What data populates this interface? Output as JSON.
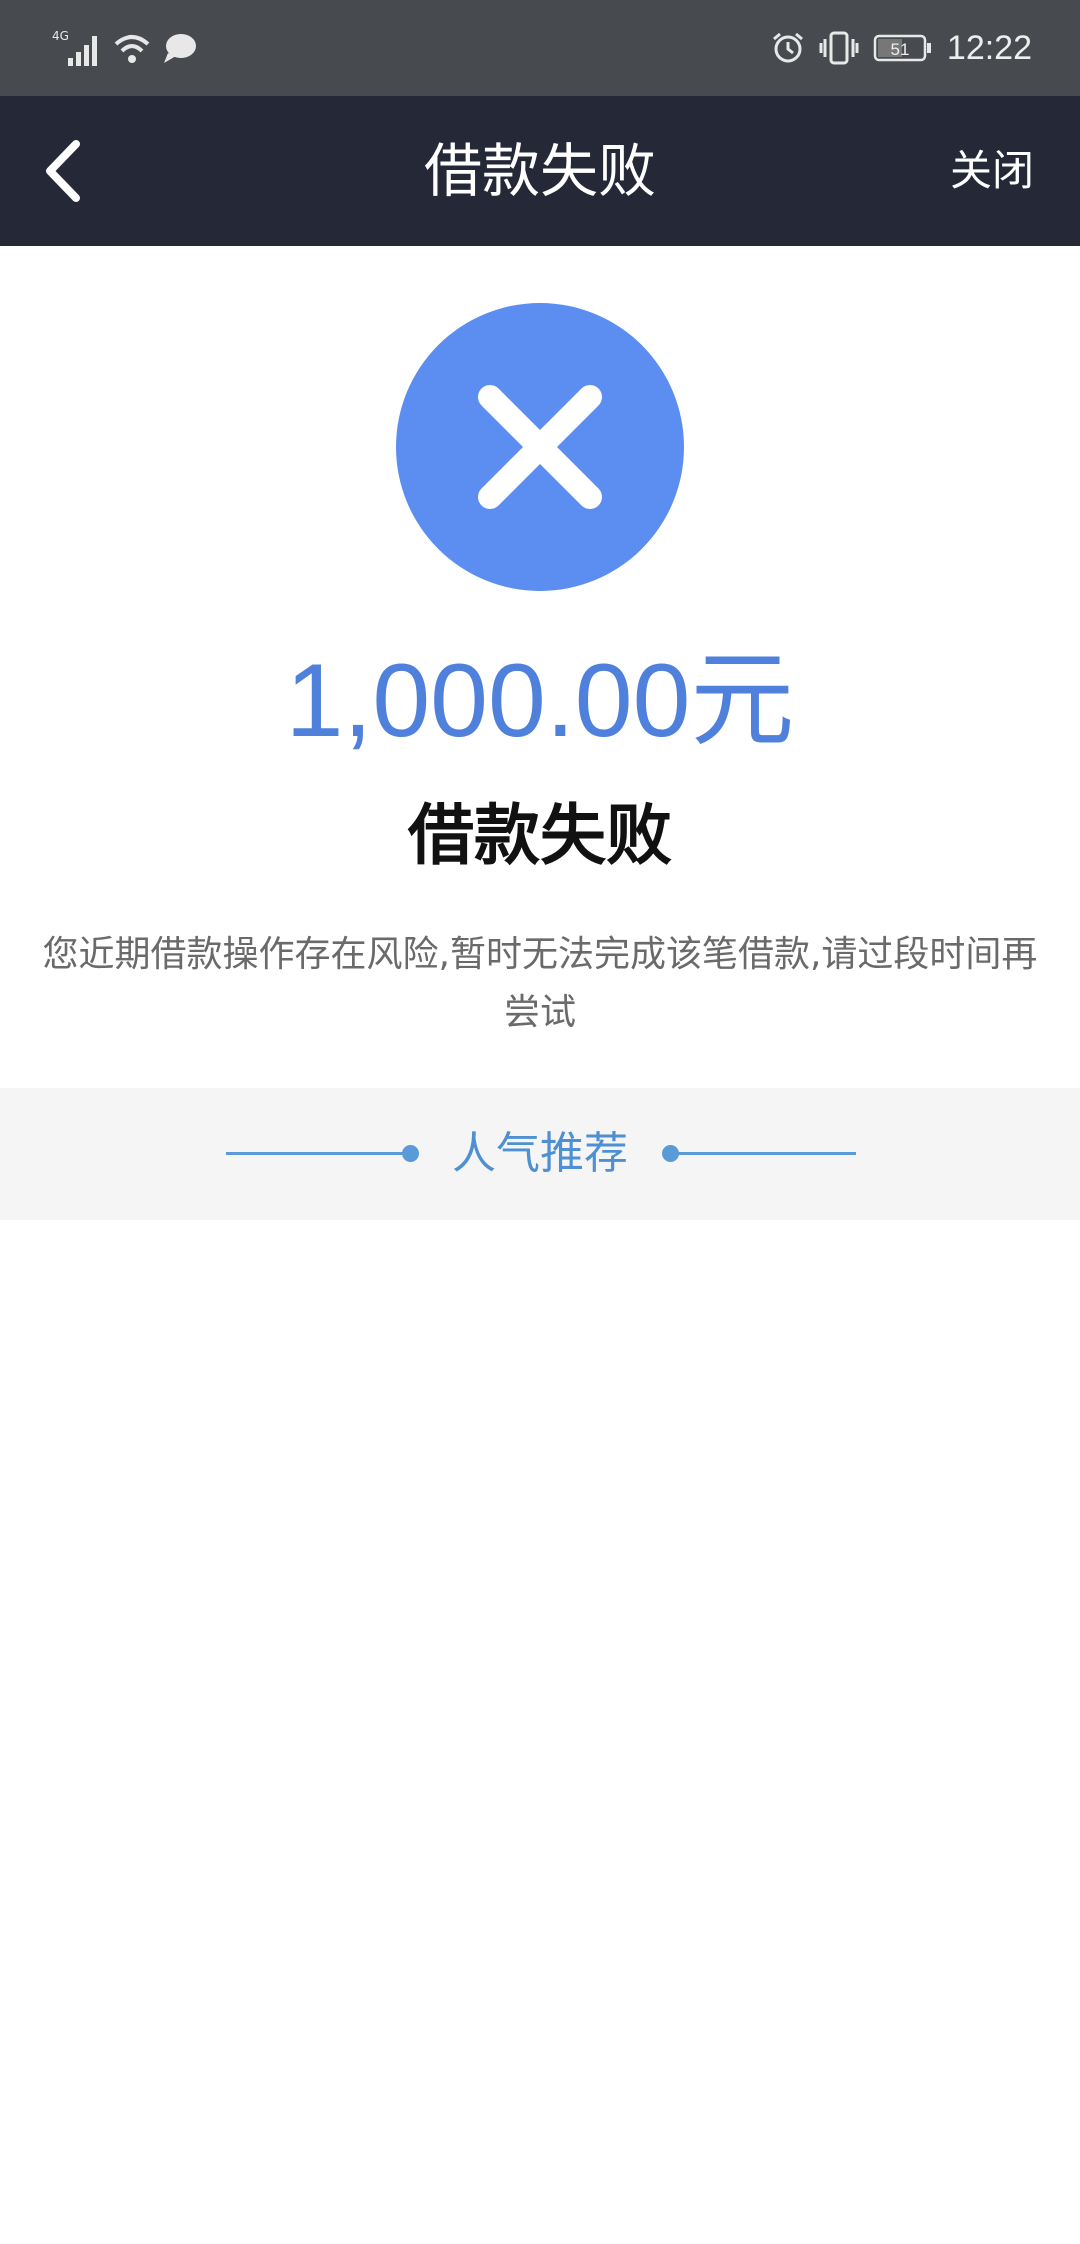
{
  "status_bar": {
    "network": "4G",
    "battery": "51",
    "time": "12:22",
    "icons": [
      "signal-icon",
      "wifi-icon",
      "message-icon",
      "alarm-icon",
      "vibrate-icon",
      "battery-icon"
    ]
  },
  "nav": {
    "title": "借款失败",
    "close_label": "关闭",
    "back_icon": "chevron-left-icon"
  },
  "result": {
    "icon": "close-circle-icon",
    "amount": "1,000.00元",
    "title": "借款失败",
    "message": "您近期借款操作存在风险,暂时无法完成该笔借款,请过段时间再尝试"
  },
  "recommend": {
    "label": "人气推荐"
  },
  "colors": {
    "status_bar_bg": "#474b4f",
    "nav_bg": "#252837",
    "accent_blue": "#5b8ef0",
    "amount_blue": "#4f80dc",
    "recommend_blue": "#5a9ad6"
  }
}
